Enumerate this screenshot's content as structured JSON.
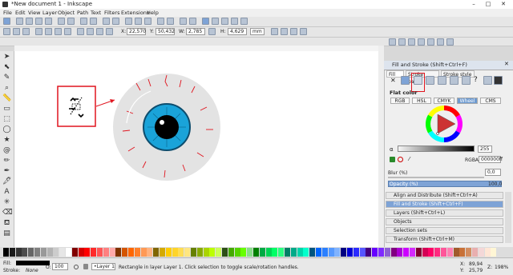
{
  "window": {
    "title": "*New document 1 - Inkscape",
    "controls": [
      "–",
      "□",
      "✕"
    ]
  },
  "menu": [
    "File",
    "Edit",
    "View",
    "Layer",
    "Object",
    "Path",
    "Text",
    "Filters",
    "Extensions",
    "Help"
  ],
  "tool_controls": {
    "x_label": "X:",
    "x_value": "22,570",
    "y_label": "Y:",
    "y_value": "50,432",
    "w_label": "W:",
    "w_value": "2,785",
    "h_label": "H:",
    "h_value": "4,629",
    "unit": "mm"
  },
  "panel": {
    "title": "Fill and Stroke (Shift+Ctrl+F)",
    "tabs": [
      "Fill",
      "Stroke paint",
      "Stroke style"
    ],
    "flat_color_label": "Flat color",
    "modes": [
      "RGB",
      "HSL",
      "CMYK",
      "Wheel",
      "CMS"
    ],
    "selected_mode": "Wheel",
    "alpha_value": "255",
    "rgba_label": "RGBA:",
    "rgba_value": "000000ff",
    "blur_label": "Blur (%)",
    "blur_value": "0,0",
    "opacity_label": "Opacity (%)",
    "opacity_value": "100,0"
  },
  "docks": [
    "Align and Distribute (Shift+Ctrl+A)",
    "Fill and Stroke (Shift+Ctrl+F)",
    "Layers (Shift+Ctrl+L)",
    "Objects",
    "Selection sets",
    "Transform (Shift+Ctrl+M)"
  ],
  "active_dock": "Fill and Stroke (Shift+Ctrl+F)",
  "status": {
    "fill_label": "Fill:",
    "stroke_label": "Stroke:",
    "stroke_value": "None",
    "opacity_label": "O:",
    "opacity_value": "100",
    "layer": "•Layer 1",
    "message": "Rectangle in layer Layer 1. Click selection to toggle scale/rotation handles.",
    "x_label": "X:",
    "x": "89,94",
    "y_label": "Y:",
    "y": "25,79",
    "zoom_label": "Z:",
    "zoom": "198%"
  },
  "colors": {
    "accent": "#e0141e",
    "iris": "#1aa3d9",
    "eyeball": "#e3e3e3"
  }
}
